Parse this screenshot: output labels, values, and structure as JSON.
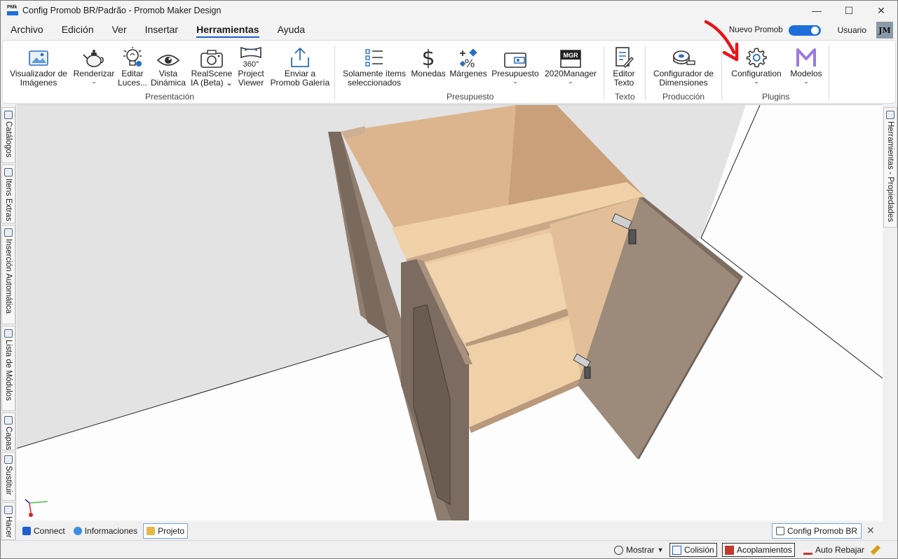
{
  "window": {
    "title": "Config Promob BR/Padrão - Promob Maker Design",
    "logo_text": "PMk",
    "minimize": "—",
    "maximize": "☐",
    "close": "✕"
  },
  "menu": {
    "tabs": [
      "Archivo",
      "Edición",
      "Ver",
      "Insertar",
      "Herramientas",
      "Ayuda"
    ],
    "active_tab": "Herramientas",
    "nuevo_promob_label": "Nuevo Promob",
    "nuevo_promob_on": true,
    "user_label": "Usuario",
    "avatar_initials": "JM"
  },
  "ribbon": {
    "groups": {
      "presentacion": "Presentación",
      "presupuesto": "Presupuesto",
      "texto": "Texto",
      "produccion": "Producción",
      "plugins": "Plugins"
    },
    "buttons": {
      "visualizador": [
        "Visualizador de",
        "Imágenes"
      ],
      "renderizar": [
        "Renderizar"
      ],
      "editar_luces": [
        "Editar",
        "Luces..."
      ],
      "vista_dinamica": [
        "Vista",
        "Dinámica"
      ],
      "realscene": [
        "RealScene",
        "IA (Beta) ⌄"
      ],
      "project_viewer": [
        "Project",
        "Viewer"
      ],
      "project_viewer_icon": "360°",
      "enviar": [
        "Enviar a",
        "Promob Galería"
      ],
      "solamente": [
        "Solamente ítems",
        "seleccionados"
      ],
      "monedas": [
        "Monedas"
      ],
      "margenes": [
        "Márgenes"
      ],
      "presupuesto": [
        "Presupuesto"
      ],
      "manager": [
        "2020Manager"
      ],
      "manager_icon": "MGR",
      "editor_texto": [
        "Editor",
        "Texto"
      ],
      "configurador": [
        "Configurador de",
        "Dimensiones"
      ],
      "configuration": [
        "Configuration"
      ],
      "modelos": [
        "Modelos"
      ]
    },
    "caret": "⌄"
  },
  "left_panel": {
    "tabs": [
      "Catálogos",
      "Itens Extras",
      "Inserción Automática",
      "Lista de Módulos",
      "Capas",
      "Sustituir",
      "Hacer"
    ]
  },
  "right_panel": {
    "tab": "Herramientas - Propiedades"
  },
  "bottom_tabs": {
    "items": [
      "Connect",
      "Informaciones",
      "Projeto"
    ],
    "active": "Projeto",
    "document_tab": "Config Promob BR",
    "close": "✕"
  },
  "status_bar": {
    "mostrar": "Mostrar",
    "colision": "Colisión",
    "acoplamientos": "Acoplamientos",
    "auto_rebajar": "Auto Rebajar"
  },
  "colors": {
    "accent": "#1e6fd9",
    "annotation_arrow": "#e8141b",
    "cabinet_interior": "#f0d1a8",
    "cabinet_exterior": "#9c8a7a"
  }
}
